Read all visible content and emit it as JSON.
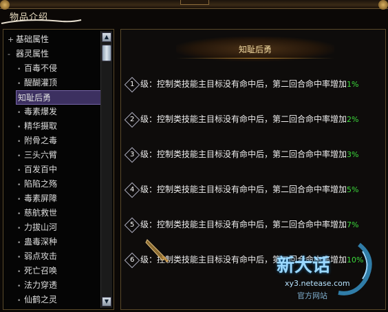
{
  "panel": {
    "title": "物品介绍"
  },
  "tree": {
    "groups": [
      {
        "label": "基础属性",
        "expander": "+"
      },
      {
        "label": "器灵属性",
        "expander": "-"
      }
    ],
    "items": [
      "百毒不侵",
      "醍醐灌顶",
      "知耻后勇",
      "毒素爆发",
      "精华摄取",
      "附骨之毒",
      "三头六臂",
      "百发百中",
      "陷陷之殇",
      "毒素屏障",
      "慈航救世",
      "力拔山河",
      "蛊毒深种",
      "弱点攻击",
      "死亡召唤",
      "法力穿透",
      "仙鹤之灵"
    ],
    "selected": "知耻后勇"
  },
  "detail": {
    "title": "知耻后勇",
    "levels": [
      {
        "num": "1",
        "prefix": "级：",
        "text": "控制类技能主目标没有命中后，第二回合命中率增加",
        "pct": "1%"
      },
      {
        "num": "2",
        "prefix": "级：",
        "text": "控制类技能主目标没有命中后，第二回合命中率增加",
        "pct": "2%"
      },
      {
        "num": "3",
        "prefix": "级：",
        "text": "控制类技能主目标没有命中后，第二回合命中率增加",
        "pct": "3%"
      },
      {
        "num": "4",
        "prefix": "级：",
        "text": "控制类技能主目标没有命中后，第二回合命中率增加",
        "pct": "5%"
      },
      {
        "num": "5",
        "prefix": "级：",
        "text": "控制类技能主目标没有命中后，第二回合命中率增加",
        "pct": "7%"
      },
      {
        "num": "6",
        "prefix": "级：",
        "text": "控制类技能主目标没有命中后，第二回合命中率增加",
        "pct": "10%"
      }
    ]
  },
  "watermark": {
    "logo": "新大话",
    "url": "xy3.netease.com",
    "sub": "官方网站"
  },
  "colors": {
    "highlight_pct": "#3cdc3c",
    "selected_bg": "#3c3060",
    "gold": "#c8963c"
  },
  "icons": [
    "expand-plus-icon",
    "collapse-minus-icon",
    "scroll-up-icon",
    "scroll-down-icon",
    "diamond-number-icon",
    "sword-cursor-icon"
  ]
}
